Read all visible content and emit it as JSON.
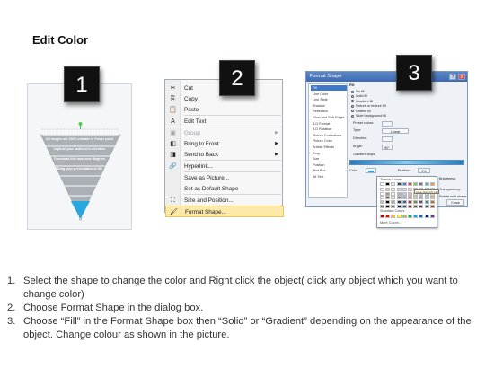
{
  "page": {
    "title": "Edit Color"
  },
  "badges": [
    "1",
    "2",
    "3"
  ],
  "pyramid": {
    "fill_color": "#adb3b9",
    "tip_color": "#29a6dd",
    "lines": [
      "All images are 100% editable in Power point",
      "Capture your audience's attention",
      "Download this awesome diagram",
      "Bring your presentation to life"
    ]
  },
  "context_menu": {
    "items": [
      {
        "label": "Cut",
        "icon": "scissors-icon",
        "glyph": "✂",
        "disabled": false,
        "submenu": false
      },
      {
        "label": "Copy",
        "icon": "copy-icon",
        "glyph": "⎘",
        "disabled": false,
        "submenu": false
      },
      {
        "label": "Paste",
        "icon": "paste-icon",
        "glyph": "📋",
        "disabled": false,
        "submenu": false
      },
      {
        "label": "Edit Text",
        "icon": "edit-text-icon",
        "glyph": "A",
        "disabled": false,
        "submenu": false
      },
      {
        "label": "Group",
        "icon": "group-icon",
        "glyph": "▣",
        "disabled": true,
        "submenu": true
      },
      {
        "label": "Bring to Front",
        "icon": "bring-front-icon",
        "glyph": "◧",
        "disabled": false,
        "submenu": true
      },
      {
        "label": "Send to Back",
        "icon": "send-back-icon",
        "glyph": "◨",
        "disabled": false,
        "submenu": true
      },
      {
        "label": "Hyperlink...",
        "icon": "hyperlink-icon",
        "glyph": "🔗",
        "disabled": false,
        "submenu": false
      },
      {
        "label": "Save as Picture...",
        "icon": "save-picture-icon",
        "glyph": "",
        "disabled": false,
        "submenu": false
      },
      {
        "label": "Set as Default Shape",
        "icon": "default-shape-icon",
        "glyph": "",
        "disabled": false,
        "submenu": false
      },
      {
        "label": "Size and Position...",
        "icon": "size-position-icon",
        "glyph": "⛶",
        "disabled": false,
        "submenu": false
      },
      {
        "label": "Format Shape...",
        "icon": "format-shape-icon",
        "glyph": "🖌",
        "disabled": false,
        "submenu": false,
        "highlight": true
      }
    ]
  },
  "format_dialog": {
    "title": "Format Shape",
    "help": "?",
    "close": "X",
    "categories": [
      "Fill",
      "Line Color",
      "Line Style",
      "Shadow",
      "Reflection",
      "Glow and Soft Edges",
      "3-D Format",
      "3-D Rotation",
      "Picture Corrections",
      "Picture Color",
      "Artistic Effects",
      "Crop",
      "Size",
      "Position",
      "Text Box",
      "Alt Text"
    ],
    "section": "Fill",
    "fill_options": [
      "No fill",
      "Solid fill",
      "Gradient fill",
      "Picture or texture fill",
      "Pattern fill",
      "Slide background fill"
    ],
    "selected_fill": 2,
    "fields": [
      {
        "label": "Preset colors:",
        "value": ""
      },
      {
        "label": "Type:",
        "value": "Linear"
      },
      {
        "label": "Direction:",
        "value": ""
      },
      {
        "label": "Angle:",
        "value": "90°"
      },
      {
        "label": "Gradient stops",
        "value": ""
      }
    ],
    "color_label": "Color",
    "position_label": "Position:",
    "position_value": "0%",
    "brightness_label": "Brightness:",
    "transparency_label": "Transparency:",
    "rotate_label": "Rotate with shape",
    "close_button": "Close"
  },
  "palette": {
    "theme_label": "Theme Colors",
    "standard_label": "Standard Colors",
    "more_label": "More Colors...",
    "tooltip": "Aqua, Accent 5, Lighter 60%",
    "theme_top": [
      "#ffffff",
      "#000000",
      "#eeece1",
      "#1f497d",
      "#4f81bd",
      "#c0504d",
      "#9bbb59",
      "#8064a2",
      "#4bacc6",
      "#f79646"
    ],
    "standard": [
      "#c00000",
      "#ff0000",
      "#ffc000",
      "#ffff00",
      "#92d050",
      "#00b050",
      "#00b0f0",
      "#0070c0",
      "#002060",
      "#7030a0"
    ]
  },
  "instructions": [
    {
      "num": "1.",
      "text": "Select the shape to change the color and Right click the object( click any object which you want to change color)"
    },
    {
      "num": "2.",
      "text": "Choose Format Shape in the dialog box."
    },
    {
      "num": "3.",
      "text": "Choose “Fill” in the Format Shape box then “Solid” or “Gradient” depending on the appearance of the object. Change colour as shown in the picture."
    }
  ]
}
